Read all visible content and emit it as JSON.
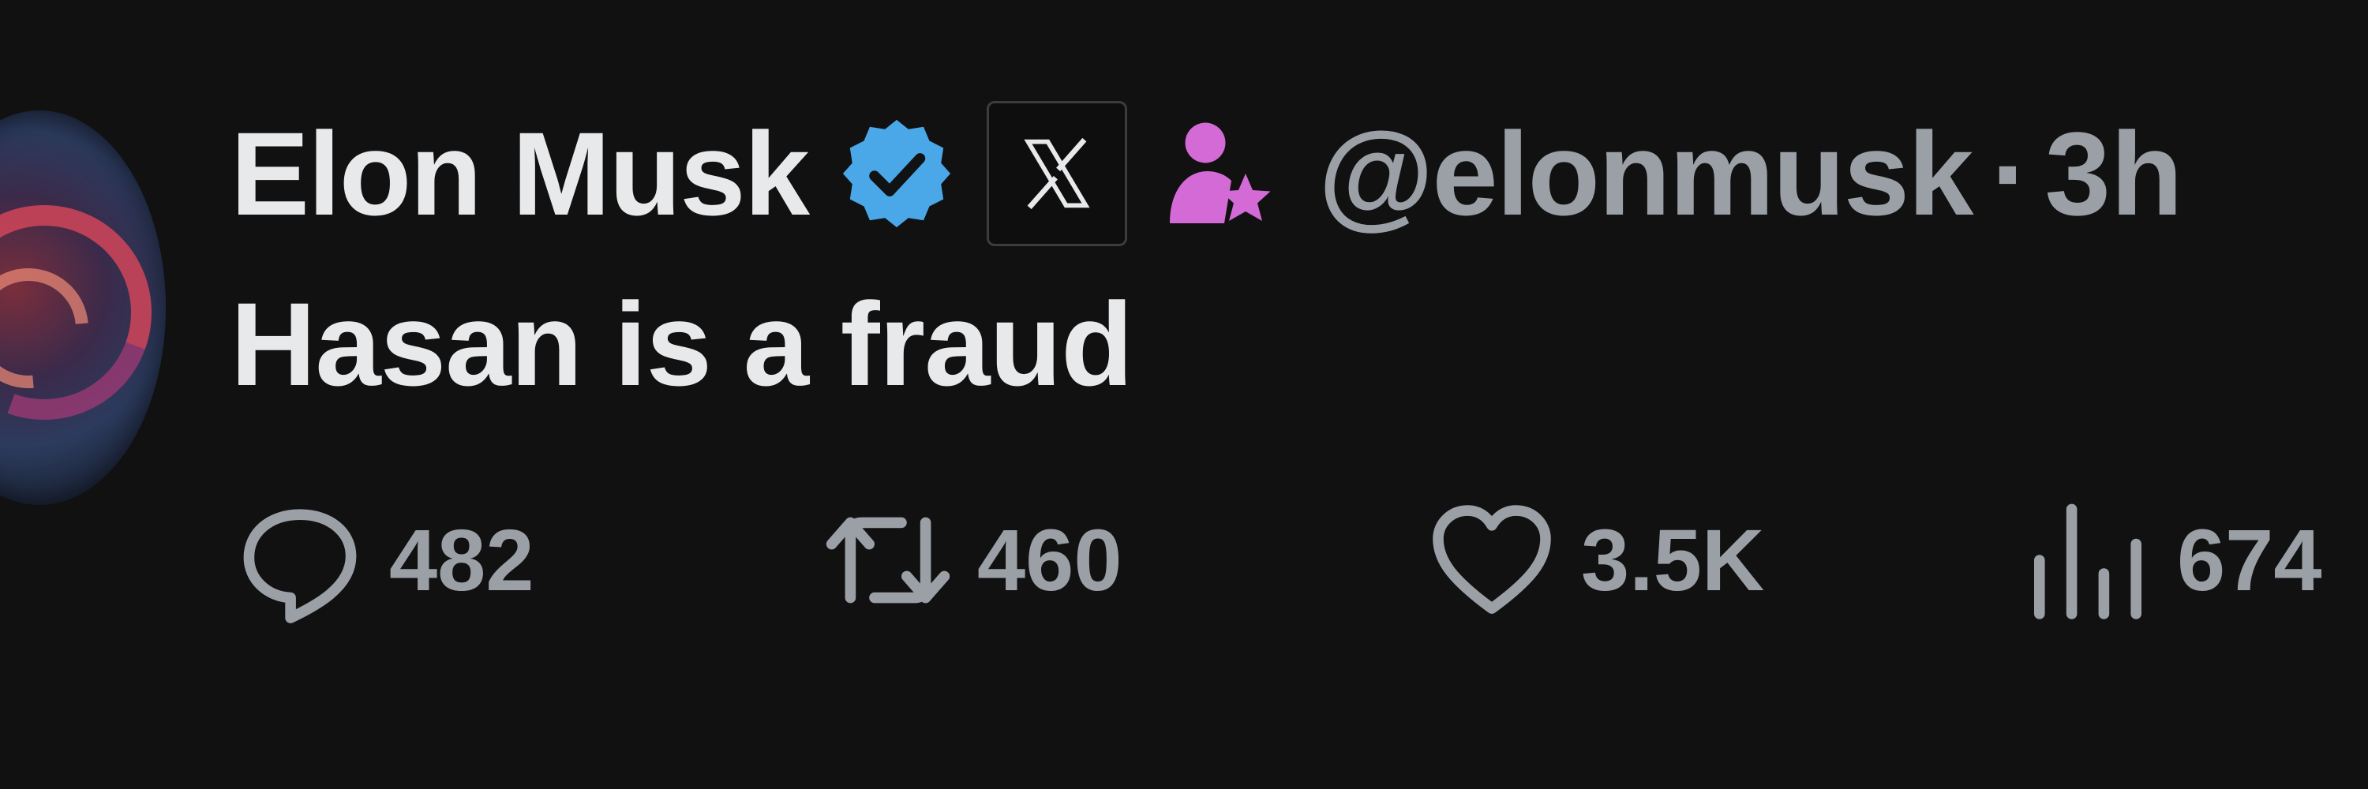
{
  "tweet": {
    "author": {
      "display_name": "Elon Musk",
      "handle": "@elonmusk",
      "verified_icon": "verified-badge-icon",
      "affiliation_icon": "x-logo-icon",
      "creator_icon": "creator-star-icon"
    },
    "separator": "·",
    "time": "3h",
    "text": "Hasan is a fraud",
    "actions": {
      "reply_count": "482",
      "retweet_count": "460",
      "like_count": "3.5K",
      "views_count": "674"
    }
  },
  "colors": {
    "background": "#111112",
    "text_primary": "#e7e9ea",
    "text_secondary": "#9aa0a6",
    "verified_blue": "#4aa8e8",
    "creator_pink": "#d46ad6"
  }
}
